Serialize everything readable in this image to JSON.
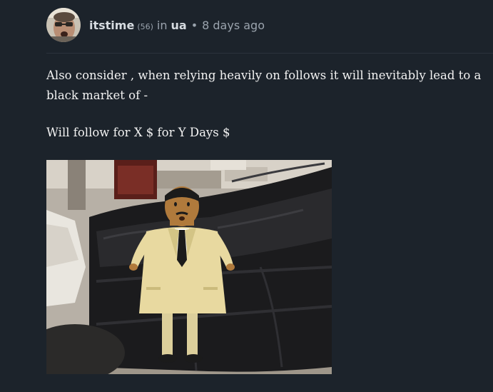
{
  "post": {
    "author": "itstime",
    "reputation": "(56)",
    "in_label": "in",
    "community": "ua",
    "bullet": "•",
    "time_ago": "8 days ago",
    "paragraphs": [
      "Also consider , when relying heavily on follows it will inevitably lead to a black market of -",
      "Will follow for X $ for Y Days $"
    ]
  },
  "colors": {
    "background": "#1c232b",
    "divider": "#2b333c",
    "text": "#f2f2f2",
    "meta": "#9aa3ad",
    "author": "#d6dbe0"
  },
  "media": {
    "type": "animated-gif",
    "icon": "cartoon-man-in-suit-on-couch"
  }
}
